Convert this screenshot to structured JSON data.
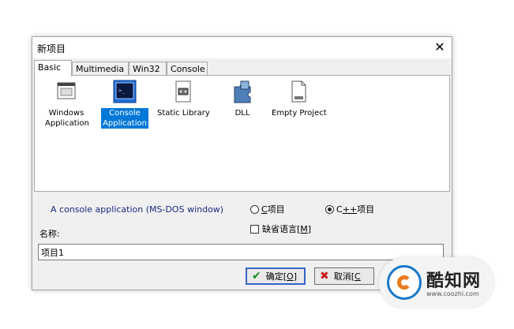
{
  "window": {
    "title": "新项目",
    "close_glyph": "✕"
  },
  "tabs": [
    {
      "label": "Basic",
      "active": true
    },
    {
      "label": "Multimedia",
      "active": false
    },
    {
      "label": "Win32",
      "active": false
    },
    {
      "label": "Console",
      "active": false
    }
  ],
  "projects": [
    {
      "line1": "Windows",
      "line2": "Application",
      "icon": "windows-app-icon",
      "selected": false
    },
    {
      "line1": "Console",
      "line2": "Application",
      "icon": "console-app-icon",
      "selected": true
    },
    {
      "line1": "Static Library",
      "line2": "",
      "icon": "static-library-icon",
      "selected": false
    },
    {
      "line1": "DLL",
      "line2": "",
      "icon": "dll-icon",
      "selected": false
    },
    {
      "line1": "Empty Project",
      "line2": "",
      "icon": "empty-project-icon",
      "selected": false
    }
  ],
  "description": "A console application (MS-DOS window)",
  "language": {
    "c": {
      "key": "C",
      "suffix": " 项目",
      "selected": false
    },
    "cpp": {
      "key": "C",
      "mid": "++",
      "suffix": " 项目",
      "selected": true
    }
  },
  "default_language": {
    "label": "缺省语言[",
    "key": "M",
    "end": "]",
    "checked": false
  },
  "name": {
    "label": "名称:",
    "value": "项目1"
  },
  "buttons": {
    "ok": {
      "label": "确定[",
      "key": "O",
      "end": "]",
      "icon": "checkmark-icon"
    },
    "cancel": {
      "label": "取消[",
      "key": "C",
      "end": "",
      "icon": "x-icon"
    }
  },
  "watermark": {
    "title": "酷知网",
    "url": "www.coozhi.com"
  }
}
